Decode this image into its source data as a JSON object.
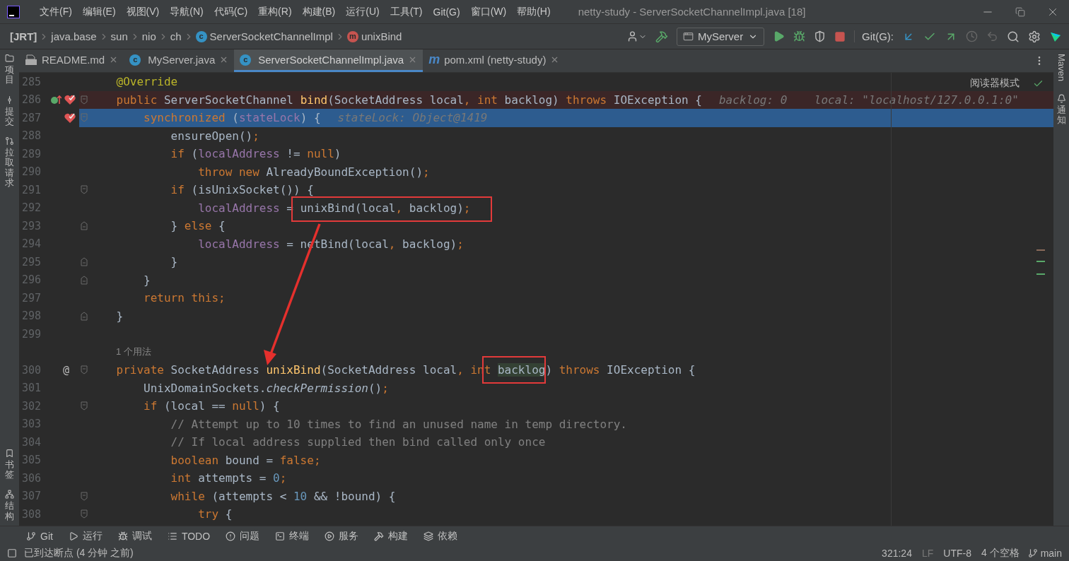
{
  "window": {
    "title": "netty-study - ServerSocketChannelImpl.java [18]"
  },
  "menu": [
    "文件(F)",
    "编辑(E)",
    "视图(V)",
    "导航(N)",
    "代码(C)",
    "重构(R)",
    "构建(B)",
    "运行(U)",
    "工具(T)",
    "Git(G)",
    "窗口(W)",
    "帮助(H)"
  ],
  "breadcrumbs": [
    {
      "label": "[JRT]",
      "kind": "plain"
    },
    {
      "label": "java.base",
      "kind": "plain"
    },
    {
      "label": "sun",
      "kind": "plain"
    },
    {
      "label": "nio",
      "kind": "plain"
    },
    {
      "label": "ch",
      "kind": "plain"
    },
    {
      "label": "ServerSocketChannelImpl",
      "kind": "class",
      "icon": "c"
    },
    {
      "label": "unixBind",
      "kind": "method",
      "icon": "m"
    }
  ],
  "toolbar": {
    "run_config": "MyServer",
    "git_label": "Git(G):"
  },
  "left_tools": [
    {
      "label": "项目",
      "kind": "folder"
    },
    {
      "label": "提交",
      "kind": "commit"
    },
    {
      "label": "拉取请求",
      "kind": "pull"
    }
  ],
  "left_tools_bottom": [
    {
      "label": "书签",
      "kind": "bookmark"
    },
    {
      "label": "结构",
      "kind": "structure"
    }
  ],
  "right_tools": [
    {
      "label": "Maven",
      "kind": "maven"
    },
    {
      "label": "通知",
      "kind": "bell"
    }
  ],
  "tabs": [
    {
      "label": "README.md",
      "kind": "markdown",
      "selected": false
    },
    {
      "label": "MyServer.java",
      "kind": "runnable",
      "icon": "c",
      "selected": false
    },
    {
      "label": "ServerSocketChannelImpl.java",
      "kind": "class",
      "icon": "c",
      "selected": true
    },
    {
      "label": "pom.xml (netty-study)",
      "kind": "maven",
      "icon": "m",
      "selected": false
    }
  ],
  "editor": {
    "reader_mode": "阅读器模式",
    "arrow": true,
    "lines": [
      {
        "number": "285",
        "kind": "plain",
        "tokens": [
          {
            "kind": "annotation",
            "t": "    @Override"
          }
        ]
      },
      {
        "number": "286",
        "kind": "breakpoint",
        "gutter": [
          {
            "kind": "implements"
          },
          {
            "kind": "breakpoint"
          },
          {
            "kind": "fold_start"
          }
        ],
        "tokens": [
          {
            "kind": "kw",
            "t": "    public "
          },
          {
            "kind": "plain",
            "t": "ServerSocketChannel "
          },
          {
            "kind": "method",
            "t": "bind"
          },
          {
            "kind": "plain",
            "t": "(SocketAddress local"
          },
          {
            "kind": "kw",
            "t": ", int "
          },
          {
            "kind": "plain",
            "t": "backlog) "
          },
          {
            "kind": "kw",
            "t": "throws "
          },
          {
            "kind": "plain",
            "t": "IOException {"
          }
        ],
        "hint": "backlog: 0    local: \"localhost/127.0.0.1:0\""
      },
      {
        "number": "287",
        "kind": "execution",
        "gutter": [
          {
            "kind": "breakpoint"
          },
          {
            "kind": "fold_start"
          }
        ],
        "tokens": [
          {
            "kind": "kw",
            "t": "        synchronized "
          },
          {
            "kind": "plain",
            "t": "("
          },
          {
            "kind": "field",
            "t": "stateLock"
          },
          {
            "kind": "plain",
            "t": ") {"
          }
        ],
        "hint": "stateLock: Object@1419"
      },
      {
        "number": "288",
        "kind": "plain",
        "tokens": [
          {
            "kind": "plain",
            "t": "            ensureOpen()"
          },
          {
            "kind": "kw",
            "t": ";"
          }
        ]
      },
      {
        "number": "289",
        "kind": "plain",
        "tokens": [
          {
            "kind": "kw",
            "t": "            if "
          },
          {
            "kind": "plain",
            "t": "("
          },
          {
            "kind": "field",
            "t": "localAddress"
          },
          {
            "kind": "plain",
            "t": " != "
          },
          {
            "kind": "kw",
            "t": "null"
          },
          {
            "kind": "plain",
            "t": ")"
          }
        ]
      },
      {
        "number": "290",
        "kind": "plain",
        "tokens": [
          {
            "kind": "kw",
            "t": "                throw new "
          },
          {
            "kind": "plain",
            "t": "AlreadyBoundException()"
          },
          {
            "kind": "kw",
            "t": ";"
          }
        ]
      },
      {
        "number": "291",
        "kind": "plain",
        "gutter": [
          {
            "kind": "fold_start"
          }
        ],
        "tokens": [
          {
            "kind": "kw",
            "t": "            if "
          },
          {
            "kind": "plain",
            "t": "(isUnixSocket()) {"
          }
        ]
      },
      {
        "number": "292",
        "kind": "plain",
        "tokens": [
          {
            "kind": "field",
            "t": "                localAddress"
          },
          {
            "kind": "plain",
            "t": " = "
          },
          {
            "kind": "group",
            "boxed": true,
            "tokens": [
              {
                "kind": "plain",
                "t": "unixBind(local"
              },
              {
                "kind": "kw",
                "t": ", "
              },
              {
                "kind": "plain",
                "t": "backlog)"
              },
              {
                "kind": "kw",
                "t": ";"
              }
            ]
          }
        ]
      },
      {
        "number": "293",
        "kind": "plain",
        "gutter": [
          {
            "kind": "fold_end"
          }
        ],
        "tokens": [
          {
            "kind": "plain",
            "t": "            } "
          },
          {
            "kind": "kw",
            "t": "else "
          },
          {
            "kind": "plain",
            "t": "{"
          }
        ]
      },
      {
        "number": "294",
        "kind": "plain",
        "tokens": [
          {
            "kind": "field",
            "t": "                localAddress"
          },
          {
            "kind": "plain",
            "t": " = netBind(local"
          },
          {
            "kind": "kw",
            "t": ", "
          },
          {
            "kind": "plain",
            "t": "backlog)"
          },
          {
            "kind": "kw",
            "t": ";"
          }
        ]
      },
      {
        "number": "295",
        "kind": "plain",
        "gutter": [
          {
            "kind": "fold_end"
          }
        ],
        "tokens": [
          {
            "kind": "plain",
            "t": "            }"
          }
        ]
      },
      {
        "number": "296",
        "kind": "plain",
        "gutter": [
          {
            "kind": "fold_end"
          }
        ],
        "tokens": [
          {
            "kind": "plain",
            "t": "        }"
          }
        ]
      },
      {
        "number": "297",
        "kind": "plain",
        "tokens": [
          {
            "kind": "kw",
            "t": "        return this;"
          }
        ]
      },
      {
        "number": "298",
        "kind": "plain",
        "gutter": [
          {
            "kind": "fold_end"
          }
        ],
        "tokens": [
          {
            "kind": "plain",
            "t": "    }"
          }
        ]
      },
      {
        "number": "299",
        "kind": "plain"
      },
      {
        "kind": "usage",
        "usages": "1 个用法"
      },
      {
        "number": "300",
        "kind": "plain",
        "gutter": [
          {
            "kind": "at",
            "text": "@"
          },
          {
            "kind": "fold_start"
          }
        ],
        "tokens": [
          {
            "kind": "kw",
            "t": "    private "
          },
          {
            "kind": "plain",
            "t": "SocketAddress "
          },
          {
            "kind": "method",
            "t": "unixBind"
          },
          {
            "kind": "plain",
            "t": "(SocketAddress local"
          },
          {
            "kind": "kw",
            "t": ", int "
          },
          {
            "kind": "group",
            "boxed": true,
            "tokens": [
              {
                "kind": "usage",
                "t": "backlog"
              }
            ]
          },
          {
            "kind": "plain",
            "t": ") "
          },
          {
            "kind": "kw",
            "t": "throws "
          },
          {
            "kind": "plain",
            "t": "IOException {"
          }
        ]
      },
      {
        "number": "301",
        "kind": "plain",
        "tokens": [
          {
            "kind": "plain",
            "t": "        UnixDomainSockets."
          },
          {
            "kind": "static",
            "t": "checkPermission"
          },
          {
            "kind": "plain",
            "t": "()"
          },
          {
            "kind": "kw",
            "t": ";"
          }
        ]
      },
      {
        "number": "302",
        "kind": "plain",
        "gutter": [
          {
            "kind": "fold_start"
          }
        ],
        "tokens": [
          {
            "kind": "kw",
            "t": "        if "
          },
          {
            "kind": "plain",
            "t": "(local == "
          },
          {
            "kind": "kw",
            "t": "null"
          },
          {
            "kind": "plain",
            "t": ") {"
          }
        ]
      },
      {
        "number": "303",
        "kind": "plain",
        "tokens": [
          {
            "kind": "comment",
            "t": "            // Attempt up to 10 times to find an unused name in temp directory."
          }
        ]
      },
      {
        "number": "304",
        "kind": "plain",
        "tokens": [
          {
            "kind": "comment",
            "t": "            // If local address supplied then bind called only once"
          }
        ]
      },
      {
        "number": "305",
        "kind": "plain",
        "tokens": [
          {
            "kind": "kw",
            "t": "            boolean "
          },
          {
            "kind": "plain",
            "t": "bound = "
          },
          {
            "kind": "kw",
            "t": "false;"
          }
        ]
      },
      {
        "number": "306",
        "kind": "plain",
        "tokens": [
          {
            "kind": "kw",
            "t": "            int "
          },
          {
            "kind": "plain",
            "t": "attempts = "
          },
          {
            "kind": "num",
            "t": "0"
          },
          {
            "kind": "kw",
            "t": ";"
          }
        ]
      },
      {
        "number": "307",
        "kind": "plain",
        "gutter": [
          {
            "kind": "fold_start"
          }
        ],
        "tokens": [
          {
            "kind": "kw",
            "t": "            while "
          },
          {
            "kind": "plain",
            "t": "(attempts < "
          },
          {
            "kind": "num",
            "t": "10"
          },
          {
            "kind": "plain",
            "t": " && !bound) {"
          }
        ]
      },
      {
        "number": "308",
        "kind": "plain",
        "gutter": [
          {
            "kind": "fold_start"
          }
        ],
        "tokens": [
          {
            "kind": "kw",
            "t": "                try "
          },
          {
            "kind": "plain",
            "t": "{"
          }
        ]
      }
    ]
  },
  "tool_windows": [
    {
      "label": "Git",
      "kind": "git"
    },
    {
      "label": "运行",
      "kind": "run"
    },
    {
      "label": "调试",
      "kind": "debug"
    },
    {
      "label": "TODO",
      "kind": "list"
    },
    {
      "label": "问题",
      "kind": "problems"
    },
    {
      "label": "终端",
      "kind": "terminal"
    },
    {
      "label": "服务",
      "kind": "services"
    },
    {
      "label": "构建",
      "kind": "build"
    },
    {
      "label": "依赖",
      "kind": "layers"
    }
  ],
  "status_bar": {
    "message": "已到达断点 (4 分钟 之前)",
    "position": "321:24",
    "line_sep": "LF",
    "encoding": "UTF-8",
    "indent": "4 个空格",
    "branch": "main"
  }
}
